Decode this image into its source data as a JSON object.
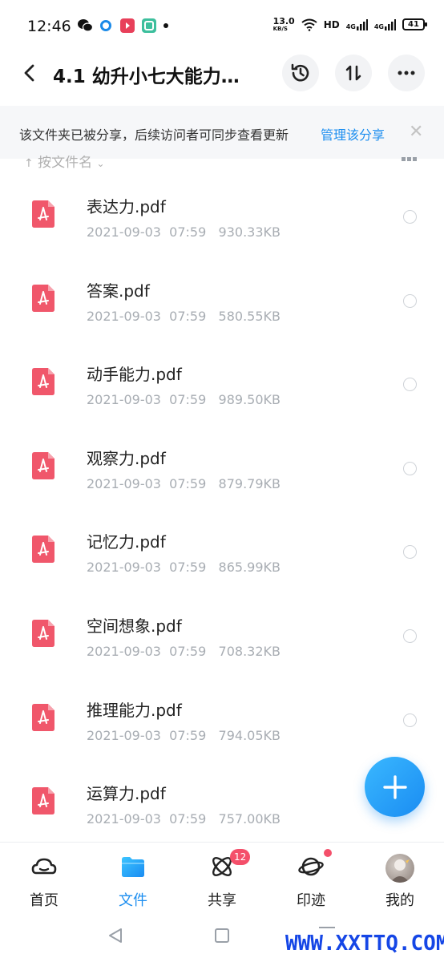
{
  "status_bar": {
    "time": "12:46",
    "net_speed": "13.0",
    "net_speed_unit": "KB/S",
    "hd": "HD",
    "sig1": "4G",
    "sig2": "4G",
    "battery": "41"
  },
  "header": {
    "title": "4.1 幼升小七大能力…",
    "history_icon": "history-icon",
    "sort_icon": "sort-icon",
    "more_icon": "more-icon"
  },
  "banner": {
    "text": "该文件夹已被分享，后续访问者可同步查看更新",
    "link": "管理该分享",
    "close": "✕"
  },
  "sort": {
    "label": "按文件名"
  },
  "files": [
    {
      "name": "表达力.pdf",
      "meta": "2021-09-03  07:59   930.33KB"
    },
    {
      "name": "答案.pdf",
      "meta": "2021-09-03  07:59   580.55KB"
    },
    {
      "name": "动手能力.pdf",
      "meta": "2021-09-03  07:59   989.50KB"
    },
    {
      "name": "观察力.pdf",
      "meta": "2021-09-03  07:59   879.79KB"
    },
    {
      "name": "记忆力.pdf",
      "meta": "2021-09-03  07:59   865.99KB"
    },
    {
      "name": "空间想象.pdf",
      "meta": "2021-09-03  07:59   708.32KB"
    },
    {
      "name": "推理能力.pdf",
      "meta": "2021-09-03  07:59   794.05KB"
    },
    {
      "name": "运算力.pdf",
      "meta": "2021-09-03  07:59   757.00KB"
    }
  ],
  "nav": {
    "home": "首页",
    "files": "文件",
    "share": "共享",
    "share_badge": "12",
    "trace": "印迹",
    "mine": "我的"
  },
  "watermark": "WWW.XXTTQ.COM",
  "colors": {
    "accent": "#1e8ff0",
    "pdf_red": "#f0576b",
    "badge": "#f44f6a"
  }
}
